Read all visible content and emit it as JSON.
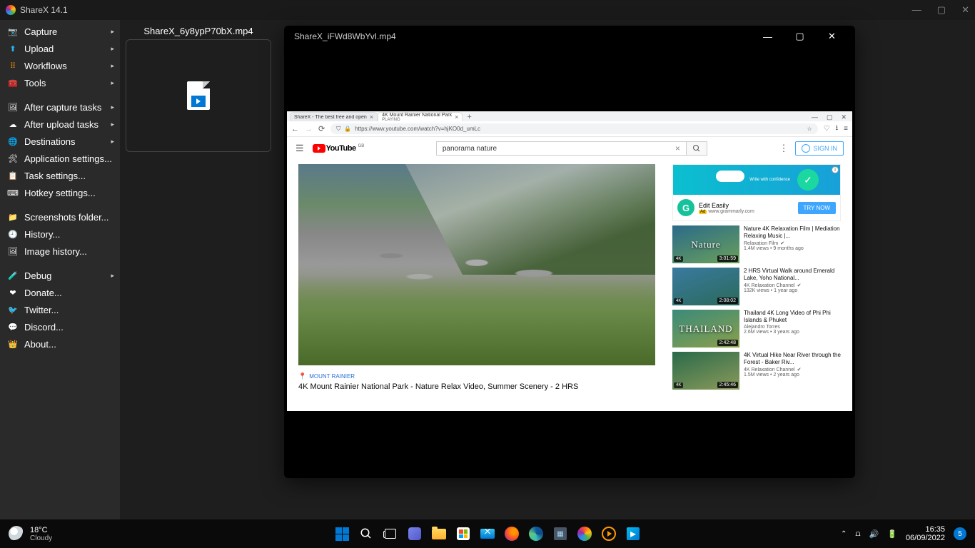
{
  "app": {
    "title": "ShareX 14.1"
  },
  "sidebar": {
    "items": [
      {
        "label": "Capture",
        "icon": "📷",
        "arrow": true,
        "color": "#4fc3f7"
      },
      {
        "label": "Upload",
        "icon": "⬆",
        "arrow": true,
        "color": "#29b6f6"
      },
      {
        "label": "Workflows",
        "icon": "⠿",
        "arrow": true,
        "color": "#ff9800"
      },
      {
        "label": "Tools",
        "icon": "🧰",
        "arrow": true,
        "color": "#ef5350"
      }
    ],
    "group2": [
      {
        "label": "After capture tasks",
        "icon": "🖼",
        "arrow": true
      },
      {
        "label": "After upload tasks",
        "icon": "☁",
        "arrow": true
      },
      {
        "label": "Destinations",
        "icon": "🌐",
        "arrow": true
      },
      {
        "label": "Application settings...",
        "icon": "🛠",
        "arrow": false
      },
      {
        "label": "Task settings...",
        "icon": "📋",
        "arrow": false
      },
      {
        "label": "Hotkey settings...",
        "icon": "⌨",
        "arrow": false
      }
    ],
    "group3": [
      {
        "label": "Screenshots folder...",
        "icon": "📁"
      },
      {
        "label": "History...",
        "icon": "🕘"
      },
      {
        "label": "Image history...",
        "icon": "🖼"
      }
    ],
    "group4": [
      {
        "label": "Debug",
        "icon": "🧪",
        "arrow": true
      },
      {
        "label": "Donate...",
        "icon": "❤"
      },
      {
        "label": "Twitter...",
        "icon": "🐦"
      },
      {
        "label": "Discord...",
        "icon": "💬"
      },
      {
        "label": "About...",
        "icon": "👑"
      }
    ]
  },
  "history": {
    "filename": "ShareX_6y8ypP70bX.mp4"
  },
  "player": {
    "title": "ShareX_iFWd8WbYvI.mp4",
    "browser": {
      "tabs": [
        {
          "label": "ShareX - The best free and open",
          "active": false
        },
        {
          "label": "4K Mount Rainier National Park",
          "sub": "PLAYING",
          "active": true
        }
      ],
      "url": "https://www.youtube.com/watch?v=hjKO0d_umLc"
    },
    "youtube": {
      "region": "GB",
      "search": "panorama nature",
      "signin": "SIGN IN",
      "tag": "MOUNT RAINIER",
      "title": "4K Mount Rainier National Park - Nature Relax Video, Summer Scenery - 2 HRS",
      "ad": {
        "title": "Edit Easily",
        "badge": "Ad",
        "url": "www.grammarly.com",
        "cta": "TRY NOW",
        "banner_text": "Write with confidence"
      },
      "recs": [
        {
          "title": "Nature 4K Relaxation Film | Mediation Relaxing Music |...",
          "channel": "Relaxation Film",
          "verified": true,
          "meta": "1.4M views • 9 months ago",
          "dur": "3:01:59",
          "fourk": "4K",
          "overlay": "Nature",
          "bg": "linear-gradient(160deg,#2a6a8a,#6aa05a)"
        },
        {
          "title": "2 HRS Virtual Walk around Emerald Lake, Yoho National...",
          "channel": "4K Relaxation Channel",
          "verified": true,
          "meta": "132K views • 1 year ago",
          "dur": "2:08:02",
          "fourk": "4K",
          "overlay": "",
          "bg": "linear-gradient(160deg,#3a7aa0,#2a6a5a)"
        },
        {
          "title": "Thailand 4K Long Video of Phi Phi Islands & Phuket",
          "channel": "Alejandro Torres",
          "verified": false,
          "meta": "2.6M views • 3 years ago",
          "dur": "2:42:48",
          "fourk": "",
          "overlay": "THAILAND",
          "bg": "linear-gradient(160deg,#3a8a7a,#8aa04a)"
        },
        {
          "title": "4K Virtual Hike Near River through the Forest - Baker Riv...",
          "channel": "4K Relaxation Channel",
          "verified": true,
          "meta": "1.5M views • 2 years ago",
          "dur": "2:45:46",
          "fourk": "4K",
          "overlay": "",
          "bg": "linear-gradient(160deg,#2a6a4a,#8a9a5a)"
        }
      ]
    }
  },
  "taskbar": {
    "weather": {
      "temp": "18°C",
      "cond": "Cloudy"
    },
    "clock": {
      "time": "16:35",
      "date": "06/09/2022"
    },
    "notif": "5"
  }
}
